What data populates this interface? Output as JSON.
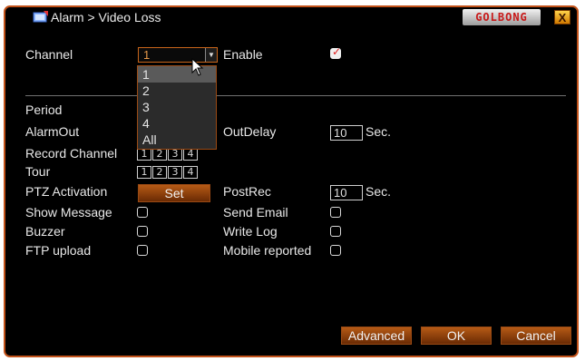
{
  "window": {
    "title": "Alarm > Video Loss",
    "logo_text": "GOLBONG",
    "close_label": "X",
    "accent_color": "#c2521a"
  },
  "channel": {
    "label": "Channel",
    "selected": "1",
    "options": [
      "1",
      "2",
      "3",
      "4",
      "All"
    ],
    "highlighted_option": "1"
  },
  "enable": {
    "label": "Enable",
    "checked": true
  },
  "period": {
    "label": "Period"
  },
  "alarm_out": {
    "label": "AlarmOut"
  },
  "out_delay": {
    "label": "OutDelay",
    "value": "10",
    "unit": "Sec."
  },
  "record_channel": {
    "label": "Record Channel",
    "channels": [
      "1",
      "2",
      "3",
      "4"
    ]
  },
  "tour": {
    "label": "Tour",
    "channels": [
      "1",
      "2",
      "3",
      "4"
    ]
  },
  "ptz": {
    "label": "PTZ Activation",
    "button": "Set"
  },
  "post_rec": {
    "label": "PostRec",
    "value": "10",
    "unit": "Sec."
  },
  "options": {
    "show_message": {
      "label": "Show Message",
      "checked": false
    },
    "send_email": {
      "label": "Send Email",
      "checked": false
    },
    "buzzer": {
      "label": "Buzzer",
      "checked": false
    },
    "write_log": {
      "label": "Write Log",
      "checked": false
    },
    "ftp_upload": {
      "label": "FTP upload",
      "checked": false
    },
    "mobile_reported": {
      "label": "Mobile reported",
      "checked": false
    }
  },
  "footer": {
    "advanced": "Advanced",
    "ok": "OK",
    "cancel": "Cancel"
  }
}
